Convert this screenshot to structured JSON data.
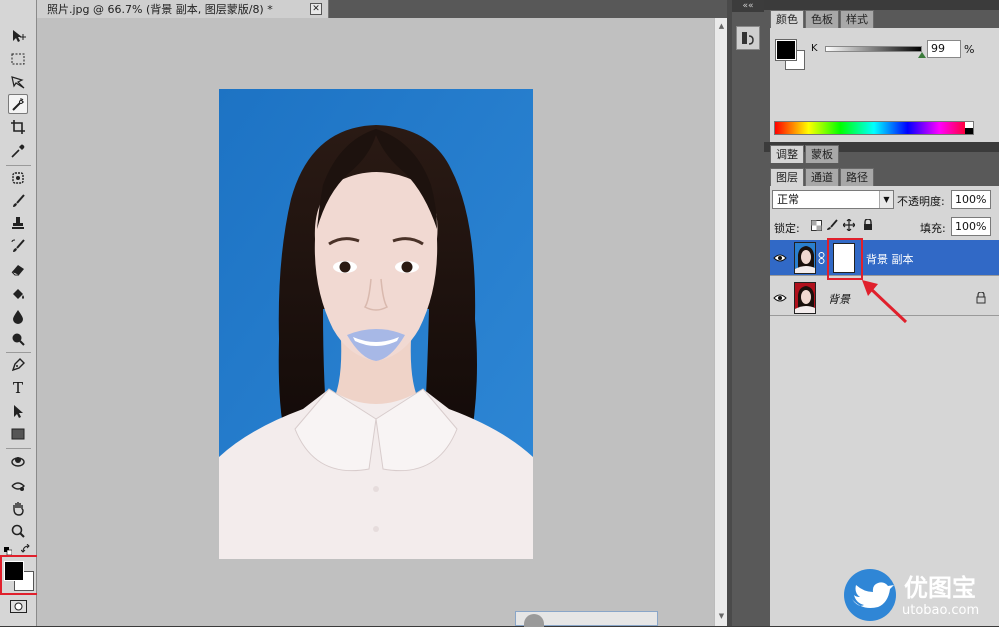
{
  "document": {
    "tab_title": "照片.jpg @ 66.7% (背景 副本, 图层蒙版/8) *",
    "close_glyph": "✕"
  },
  "toolbar": {
    "tools": [
      "move-tool",
      "marquee-tool",
      "lasso-tool",
      "magic-wand-tool",
      "crop-tool",
      "eyedropper-tool",
      "healing-brush-tool",
      "brush-tool",
      "clone-stamp-tool",
      "history-brush-tool",
      "eraser-tool",
      "paint-bucket-tool",
      "blur-tool",
      "dodge-tool",
      "pen-tool",
      "type-tool",
      "path-selection-tool",
      "rectangle-tool",
      "3d-rotate-tool",
      "3d-orbit-tool",
      "hand-tool",
      "zoom-tool"
    ],
    "selected_tool": "magic-wand-tool",
    "type_tool_glyph": "T",
    "foreground_color": "#000000",
    "background_color": "#ffffff"
  },
  "color_panel": {
    "tabs": [
      "颜色",
      "色板",
      "样式"
    ],
    "active_tab": "颜色",
    "channel_label": "K",
    "value": "99",
    "unit": "%",
    "value_fraction": 0.99
  },
  "adjust_panel": {
    "tabs": [
      "调整",
      "蒙板"
    ],
    "active_tab": "调整"
  },
  "layers_panel": {
    "tabs": [
      "图层",
      "通道",
      "路径"
    ],
    "active_tab": "图层",
    "blend_mode": "正常",
    "opacity_label": "不透明度:",
    "opacity_value": "100%",
    "lock_label": "锁定:",
    "fill_label": "填充:",
    "fill_value": "100%",
    "layers": [
      {
        "name": "背景 副本",
        "selected": true,
        "visible": true,
        "has_mask": true
      },
      {
        "name": "背景",
        "selected": false,
        "visible": true,
        "locked": true
      }
    ]
  },
  "watermark": {
    "title": "优图宝",
    "url": "utobao.com"
  },
  "colors": {
    "highlight_red": "#e0202c",
    "selection_blue": "#3169c6",
    "photo_background_blue": "#2a7fce"
  }
}
